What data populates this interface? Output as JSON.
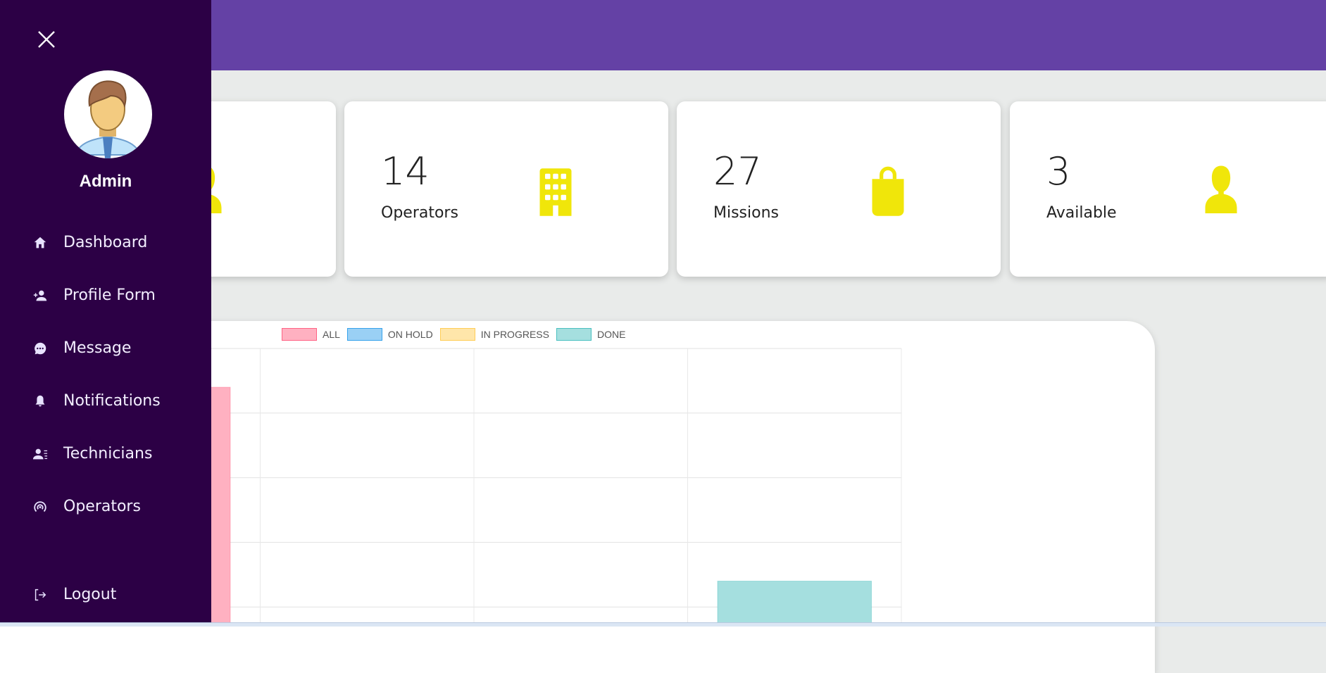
{
  "sidebar": {
    "user": "Admin",
    "items": [
      {
        "label": "Dashboard",
        "icon": "home-icon"
      },
      {
        "label": "Profile Form",
        "icon": "person-add-icon"
      },
      {
        "label": "Message",
        "icon": "chat-icon"
      },
      {
        "label": "Notifications",
        "icon": "bell-icon"
      },
      {
        "label": "Technicians",
        "icon": "person-list-icon"
      },
      {
        "label": "Operators",
        "icon": "broadcast-icon"
      }
    ],
    "logout": "Logout"
  },
  "cards": [
    {
      "value": "14",
      "label": "Operators",
      "icon": "building-icon"
    },
    {
      "value": "27",
      "label": "Missions",
      "icon": "bag-icon"
    },
    {
      "value": "3",
      "label": "Available",
      "icon": "person-icon"
    }
  ],
  "colors": {
    "header": "#6441a5",
    "sidebar": "#2c0045",
    "icon": "#f0e60a"
  },
  "chart_data": {
    "type": "bar",
    "categories": [
      "ALL",
      "ON HOLD",
      "IN PROGRESS",
      "DONE"
    ],
    "series": [
      {
        "name": "ALL",
        "color": "#ffb1c1",
        "values": [
          22,
          0,
          0,
          0
        ]
      },
      {
        "name": "ON HOLD",
        "color": "#9ad0f5",
        "values": [
          0,
          0,
          0,
          0
        ]
      },
      {
        "name": "IN PROGRESS",
        "color": "#ffe6aa",
        "values": [
          0,
          0,
          0,
          0
        ]
      },
      {
        "name": "DONE",
        "color": "#a5dfdf",
        "values": [
          0,
          0,
          0,
          7
        ]
      }
    ],
    "ylim": [
      0,
      25
    ],
    "grid": true,
    "legend": "top"
  }
}
